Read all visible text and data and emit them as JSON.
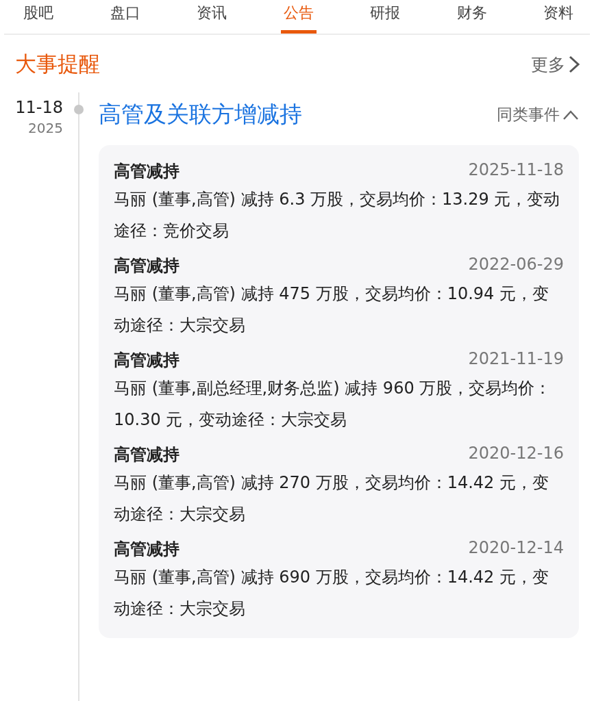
{
  "tabs": [
    {
      "label": "股吧",
      "selected": false
    },
    {
      "label": "盘口",
      "selected": false
    },
    {
      "label": "资讯",
      "selected": false
    },
    {
      "label": "公告",
      "selected": true
    },
    {
      "label": "研报",
      "selected": false
    },
    {
      "label": "财务",
      "selected": false
    },
    {
      "label": "资料",
      "selected": false
    }
  ],
  "section": {
    "title": "大事提醒",
    "more": "更多"
  },
  "event": {
    "date": "11-18",
    "year": "2025",
    "title": "高管及关联方增减持",
    "similar": "同类事件",
    "expanded": true,
    "items": [
      {
        "title": "高管减持",
        "date": "2025-11-18",
        "text": "马丽 (董事,高管) 减持 6.3 万股，交易均价：13.29 元，变动途径：竞价交易"
      },
      {
        "title": "高管减持",
        "date": "2022-06-29",
        "text": "马丽 (董事,高管) 减持 475 万股，交易均价：10.94 元，变动途径：大宗交易"
      },
      {
        "title": "高管减持",
        "date": "2021-11-19",
        "text": "马丽 (董事,副总经理,财务总监) 减持 960 万股，交易均价：10.30 元，变动途径：大宗交易"
      },
      {
        "title": "高管减持",
        "date": "2020-12-16",
        "text": "马丽 (董事,高管) 减持 270 万股，交易均价：14.42 元，变动途径：大宗交易"
      },
      {
        "title": "高管减持",
        "date": "2020-12-14",
        "text": "马丽 (董事,高管) 减持 690 万股，交易均价：14.42 元，变动途径：大宗交易"
      }
    ]
  }
}
